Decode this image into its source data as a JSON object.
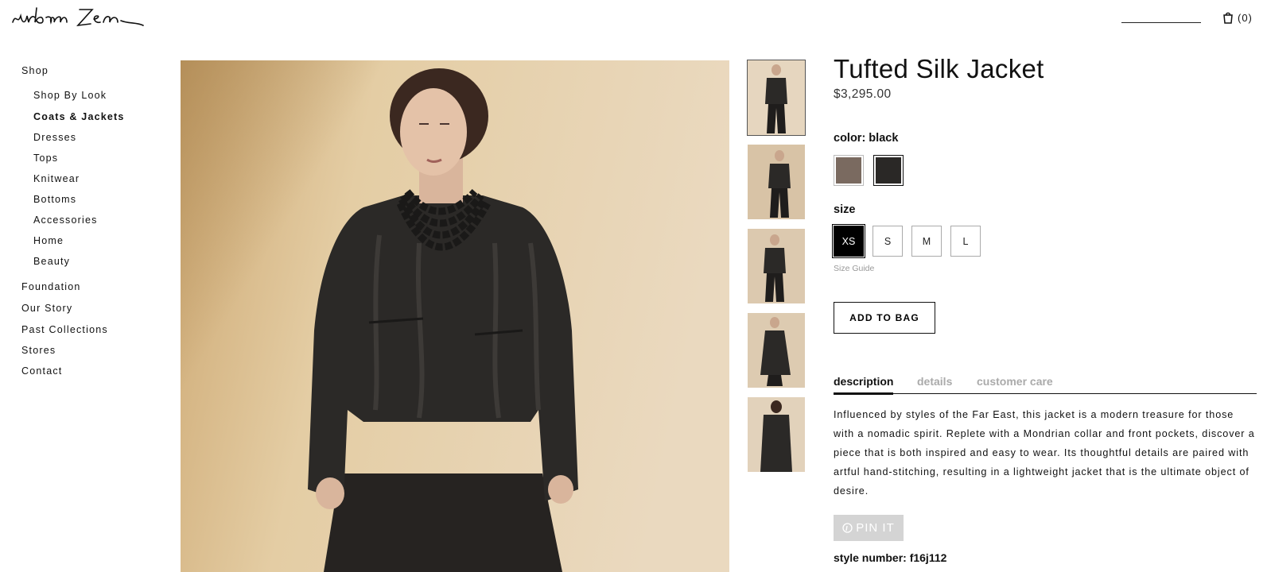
{
  "brand": {
    "logo_text": "urban Zen"
  },
  "header": {
    "cart_count": "(0)"
  },
  "nav": {
    "shop": "Shop",
    "shop_items": [
      "Shop By Look",
      "Coats & Jackets",
      "Dresses",
      "Tops",
      "Knitwear",
      "Bottoms",
      "Accessories",
      "Home",
      "Beauty"
    ],
    "active_item": "Coats & Jackets",
    "main_items": [
      "Foundation",
      "Our Story",
      "Past Collections",
      "Stores",
      "Contact"
    ]
  },
  "gallery": {
    "thumbnail_count": 5,
    "selected_index": 0
  },
  "product": {
    "title": "Tufted Silk Jacket",
    "price": "$3,295.00",
    "color_label": "color: black",
    "colors": [
      {
        "name": "taupe",
        "hex": "#7a6a60"
      },
      {
        "name": "black",
        "hex": "#2a2826"
      }
    ],
    "selected_color": "black",
    "size_label": "size",
    "sizes": [
      "XS",
      "S",
      "M",
      "L"
    ],
    "selected_size": "XS",
    "size_guide": "Size Guide",
    "add_to_bag": "ADD TO BAG",
    "tabs": [
      "description",
      "details",
      "customer care"
    ],
    "active_tab": "description",
    "description": "Influenced by styles of the Far East, this jacket is a modern treasure for those with a nomadic spirit. Replete with a Mondrian collar and front pockets, discover a piece that is both inspired and easy to wear. Its thoughtful details are paired with artful hand-stitching, resulting in a lightweight jacket that is the ultimate object of desire.",
    "pin_it": "PIN IT",
    "style_number": "style number: f16j112"
  },
  "colors": {
    "text": "#111111",
    "muted": "#aaaaaa",
    "pin_bg": "#d4d4d4"
  }
}
